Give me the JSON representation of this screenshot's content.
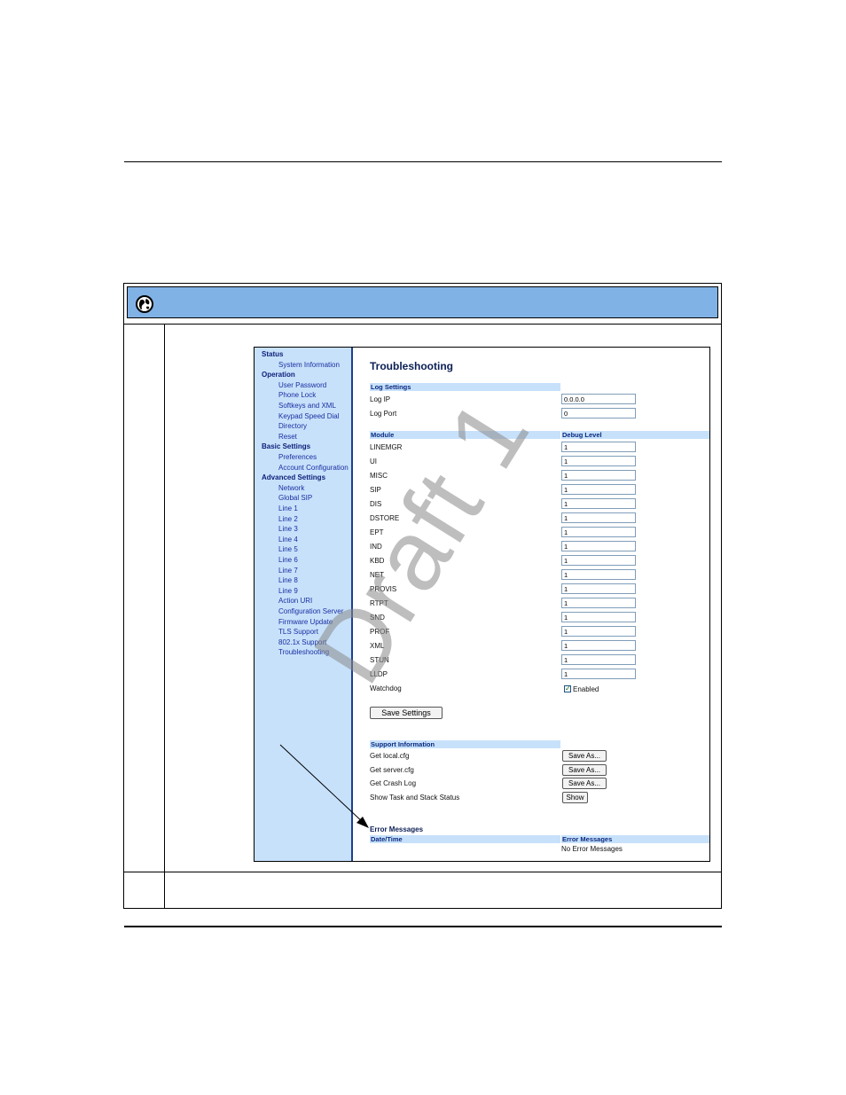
{
  "watermark": "Draft 1",
  "colors": {
    "header_band": "#80b2e6",
    "sidebar_bg": "#c7e1fb",
    "sidebar_border": "#1d3f8e"
  },
  "icons": {
    "header": "globe-icon"
  },
  "sidebar": {
    "items": [
      {
        "label": "Status",
        "level": 0
      },
      {
        "label": "System Information",
        "level": 1
      },
      {
        "label": "Operation",
        "level": 0
      },
      {
        "label": "User Password",
        "level": 1
      },
      {
        "label": "Phone Lock",
        "level": 1
      },
      {
        "label": "Softkeys and XML",
        "level": 1
      },
      {
        "label": "Keypad Speed Dial",
        "level": 1
      },
      {
        "label": "Directory",
        "level": 1
      },
      {
        "label": "Reset",
        "level": 1
      },
      {
        "label": "Basic Settings",
        "level": 0
      },
      {
        "label": "Preferences",
        "level": 1
      },
      {
        "label": "Account Configuration",
        "level": 1
      },
      {
        "label": "Advanced Settings",
        "level": 0
      },
      {
        "label": "Network",
        "level": 1
      },
      {
        "label": "Global SIP",
        "level": 1
      },
      {
        "label": "Line 1",
        "level": 1
      },
      {
        "label": "Line 2",
        "level": 1
      },
      {
        "label": "Line 3",
        "level": 1
      },
      {
        "label": "Line 4",
        "level": 1
      },
      {
        "label": "Line 5",
        "level": 1
      },
      {
        "label": "Line 6",
        "level": 1
      },
      {
        "label": "Line 7",
        "level": 1
      },
      {
        "label": "Line 8",
        "level": 1
      },
      {
        "label": "Line 9",
        "level": 1
      },
      {
        "label": "Action URI",
        "level": 1
      },
      {
        "label": "Configuration Server",
        "level": 1
      },
      {
        "label": "Firmware Update",
        "level": 1
      },
      {
        "label": "TLS Support",
        "level": 1
      },
      {
        "label": "802.1x Support",
        "level": 1
      },
      {
        "label": "Troubleshooting",
        "level": 1
      }
    ]
  },
  "main": {
    "title": "Troubleshooting",
    "log_settings": {
      "header": "Log Settings",
      "log_ip_label": "Log IP",
      "log_ip_value": "0.0.0.0",
      "log_port_label": "Log Port",
      "log_port_value": "0"
    },
    "module_table": {
      "col_module": "Module",
      "col_debug": "Debug Level",
      "rows": [
        {
          "module": "LINEMGR",
          "level": "1"
        },
        {
          "module": "UI",
          "level": "1"
        },
        {
          "module": "MISC",
          "level": "1"
        },
        {
          "module": "SIP",
          "level": "1"
        },
        {
          "module": "DIS",
          "level": "1"
        },
        {
          "module": "DSTORE",
          "level": "1"
        },
        {
          "module": "EPT",
          "level": "1"
        },
        {
          "module": "IND",
          "level": "1"
        },
        {
          "module": "KBD",
          "level": "1"
        },
        {
          "module": "NET",
          "level": "1"
        },
        {
          "module": "PROVIS",
          "level": "1"
        },
        {
          "module": "RTPT",
          "level": "1"
        },
        {
          "module": "SND",
          "level": "1"
        },
        {
          "module": "PROF",
          "level": "1"
        },
        {
          "module": "XML",
          "level": "1"
        },
        {
          "module": "STUN",
          "level": "1"
        },
        {
          "module": "LLDP",
          "level": "1"
        }
      ]
    },
    "watchdog": {
      "label": "Watchdog",
      "checkbox_mark": "✓",
      "enabled_label": "Enabled"
    },
    "save_button": "Save Settings",
    "support": {
      "header": "Support Information",
      "rows": [
        {
          "label": "Get local.cfg",
          "button": "Save As..."
        },
        {
          "label": "Get server.cfg",
          "button": "Save As..."
        },
        {
          "label": "Get Crash Log",
          "button": "Save As..."
        },
        {
          "label": "Show Task and Stack Status",
          "button": "Show"
        }
      ]
    },
    "errors": {
      "title": "Error Messages",
      "col_datetime": "Date/Time",
      "col_messages": "Error Messages",
      "value": "No Error Messages"
    }
  }
}
